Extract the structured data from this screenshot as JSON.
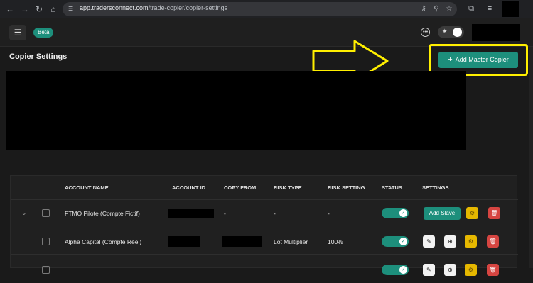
{
  "browser": {
    "url_host": "app.tradersconnect.com",
    "url_path": "/trade-copier/copier-settings"
  },
  "app": {
    "badge": "Beta",
    "page_title": "Copier Settings",
    "add_master_label": "Add Master Copier"
  },
  "table": {
    "headers": {
      "account_name": "ACCOUNT NAME",
      "account_id": "ACCOUNT ID",
      "copy_from": "COPY FROM",
      "risk_type": "RISK TYPE",
      "risk_setting": "RISK SETTING",
      "status": "STATUS",
      "settings": "SETTINGS"
    },
    "rows": [
      {
        "account_name": "FTMO Pilote (Compte Fictif)",
        "copy_from": "-",
        "risk_type": "-",
        "risk_setting": "-",
        "action": "Add Slave"
      },
      {
        "account_name": "Alpha Capital (Compte Réel)",
        "copy_from": "",
        "risk_type": "Lot Multiplier",
        "risk_setting": "100%"
      }
    ]
  },
  "colors": {
    "accent": "#1d8f7c",
    "highlight": "#ffef00",
    "danger": "#d64541",
    "warning": "#e6b800"
  }
}
